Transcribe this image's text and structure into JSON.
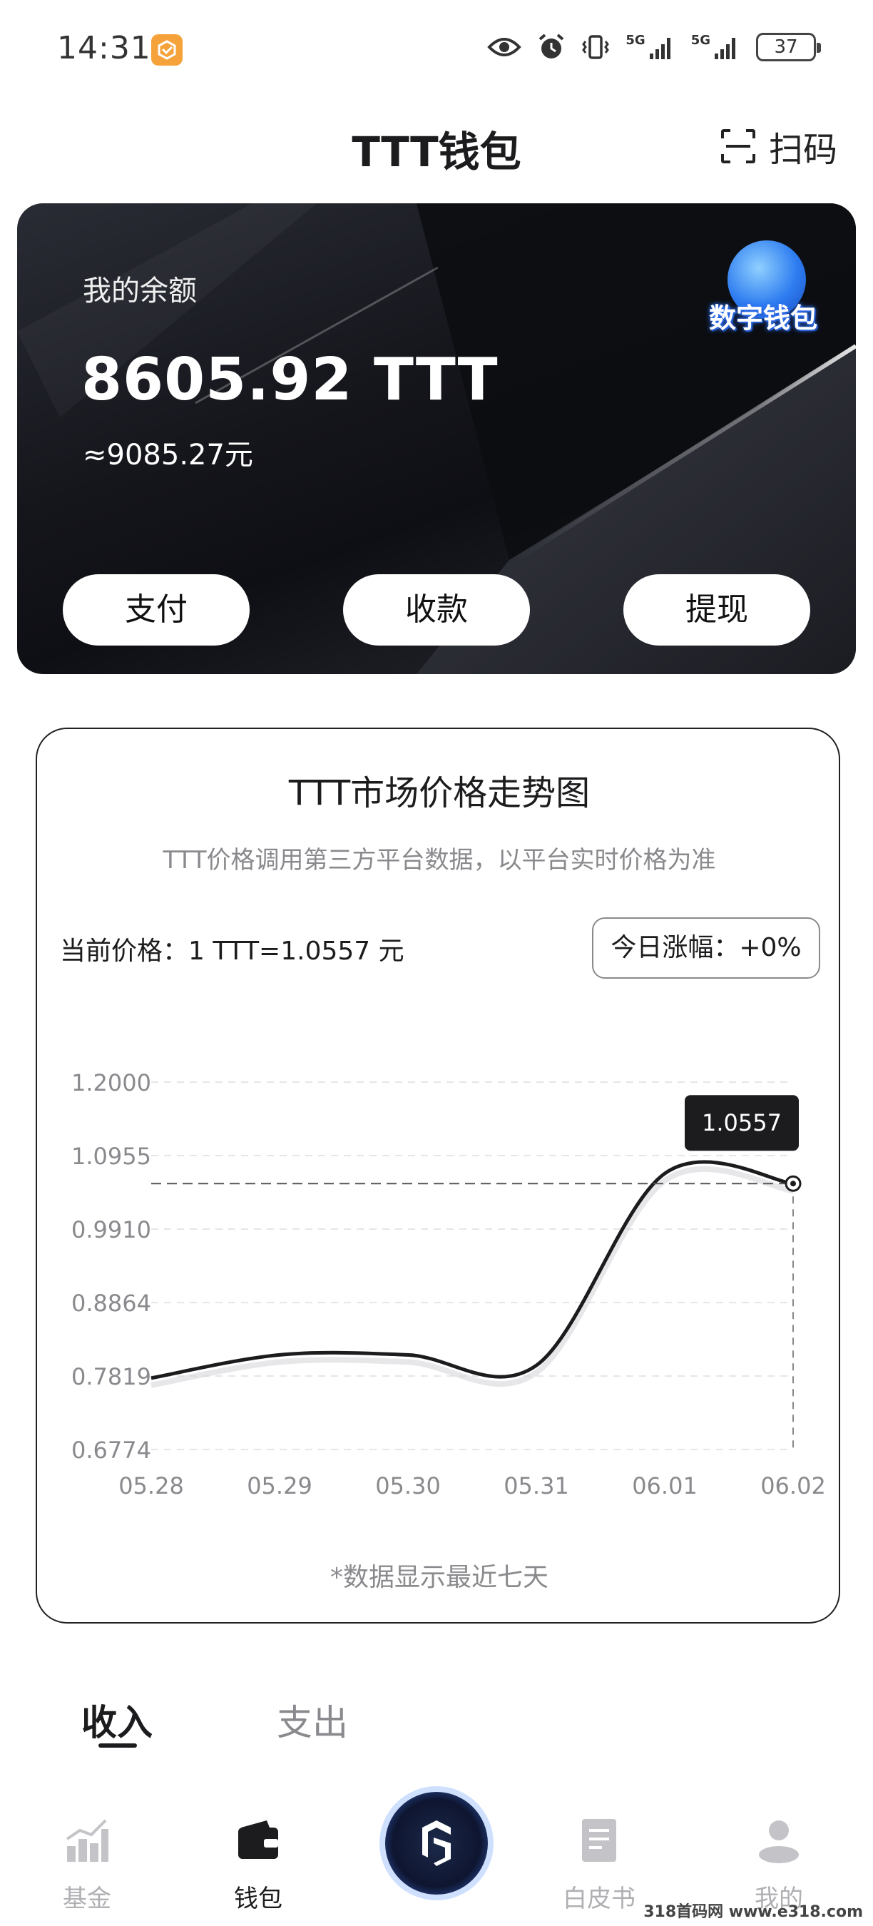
{
  "status_bar": {
    "time": "14:31",
    "signal_1": "5G",
    "signal_2": "5G",
    "battery": "37"
  },
  "header": {
    "title": "TTT钱包",
    "scan_label": "扫码"
  },
  "balance_card": {
    "label": "我的余额",
    "amount": "8605.92 TTT",
    "fiat": "≈9085.27元",
    "badge": "数字钱包",
    "actions": [
      {
        "label": "支付"
      },
      {
        "label": "收款"
      },
      {
        "label": "提现"
      }
    ]
  },
  "market": {
    "title": "TTT市场价格走势图",
    "subtitle": "TTT价格调用第三方平台数据，以平台实时价格为准",
    "current_price": "当前价格：1 TTT=1.0557 元",
    "change": "今日涨幅：+0%",
    "note": "*数据显示最近七天",
    "tooltip": "1.0557"
  },
  "chart_data": {
    "type": "line",
    "x": [
      "05.28",
      "05.29",
      "05.30",
      "05.31",
      "06.01",
      "06.02"
    ],
    "values": [
      0.779,
      0.812,
      0.812,
      0.797,
      1.07,
      1.0557
    ],
    "y_ticks": [
      "1.2000",
      "1.0955",
      "0.9910",
      "0.8864",
      "0.7819",
      "0.6774"
    ],
    "ylim": [
      0.6774,
      1.2
    ],
    "grid": true,
    "highlight": {
      "x": "06.02",
      "value": 1.0557
    }
  },
  "tabs": [
    {
      "label": "收入"
    },
    {
      "label": "支出"
    }
  ],
  "bottom_nav": [
    {
      "label": "基金"
    },
    {
      "label": "钱包"
    },
    {
      "label": ""
    },
    {
      "label": "白皮书"
    },
    {
      "label": "我的"
    }
  ],
  "watermark": "318首码网 www.e318.com"
}
